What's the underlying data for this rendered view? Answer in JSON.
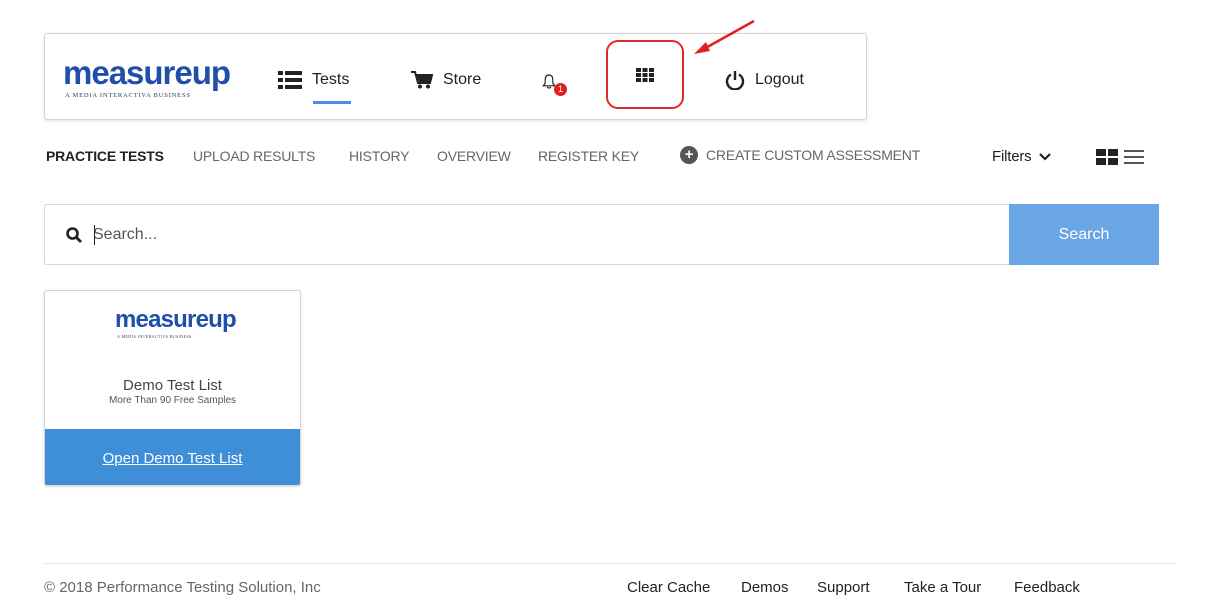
{
  "nav": {
    "logo_word": "measureup",
    "logo_sub": "A MEDIA INTERACTIVA BUSINESS",
    "tests_label": "Tests",
    "store_label": "Store",
    "notification_count": "1",
    "logout_label": "Logout"
  },
  "submenu": {
    "practice_tests": "PRACTICE TESTS",
    "upload_results": "UPLOAD RESULTS",
    "history": "HISTORY",
    "overview": "OVERVIEW",
    "register_key": "REGISTER KEY",
    "create_custom": "CREATE CUSTOM ASSESSMENT",
    "filters": "Filters"
  },
  "search": {
    "placeholder": "Search...",
    "button_label": "Search"
  },
  "card": {
    "logo_word": "measureup",
    "logo_sub": "A MEDIA INTERACTIVA BUSINESS",
    "title": "Demo Test List",
    "subtitle": "More Than 90 Free Samples",
    "link_label": "Open Demo Test List"
  },
  "footer": {
    "copyright": "© 2018 Performance Testing Solution, Inc",
    "links": [
      "Clear Cache",
      "Demos",
      "Support",
      "Take a Tour",
      "Feedback"
    ]
  },
  "colors": {
    "brand_blue": "#1f4fa8",
    "accent_blue": "#4a90e2",
    "search_button": "#6aa5e6",
    "card_footer": "#3f8ed8",
    "highlight_red": "#e02a2a"
  },
  "icons": [
    "list-icon",
    "cart-icon",
    "bell-icon",
    "apps-grid-icon",
    "power-icon",
    "search-icon",
    "plus-circle-icon",
    "chevron-down-icon",
    "grid-view-icon",
    "list-view-icon"
  ]
}
